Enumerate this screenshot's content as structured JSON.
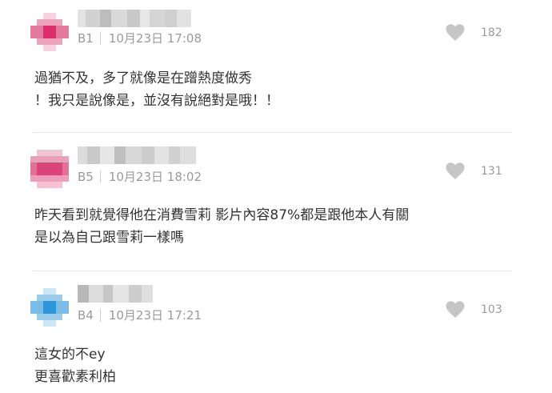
{
  "comments": [
    {
      "floor": "B1",
      "time": "10月23日 17:08",
      "likes": "182",
      "lines": [
        "過猶不及，多了就像是在蹭熱度做秀",
        "！我只是說像是，並沒有說絕對是哦！！"
      ]
    },
    {
      "floor": "B5",
      "time": "10月23日 18:02",
      "likes": "131",
      "lines": [
        "昨天看到就覺得他在消費雪莉 影片內容87%都是跟他本人有關",
        "是以為自己跟雪莉一樣嗎"
      ]
    },
    {
      "floor": "B4",
      "time": "10月23日 17:21",
      "likes": "103",
      "lines": [
        "這女的不ey",
        "更喜歡素利柏"
      ]
    }
  ],
  "colors": {
    "avatar_pink": "#e0457a",
    "avatar_blue": "#3da3e0",
    "meta_gray": "#9a9a9a",
    "heart_gray": "#c6c6c6"
  },
  "icons": {
    "like": "heart-icon",
    "avatar": "pixelated-avatar"
  }
}
